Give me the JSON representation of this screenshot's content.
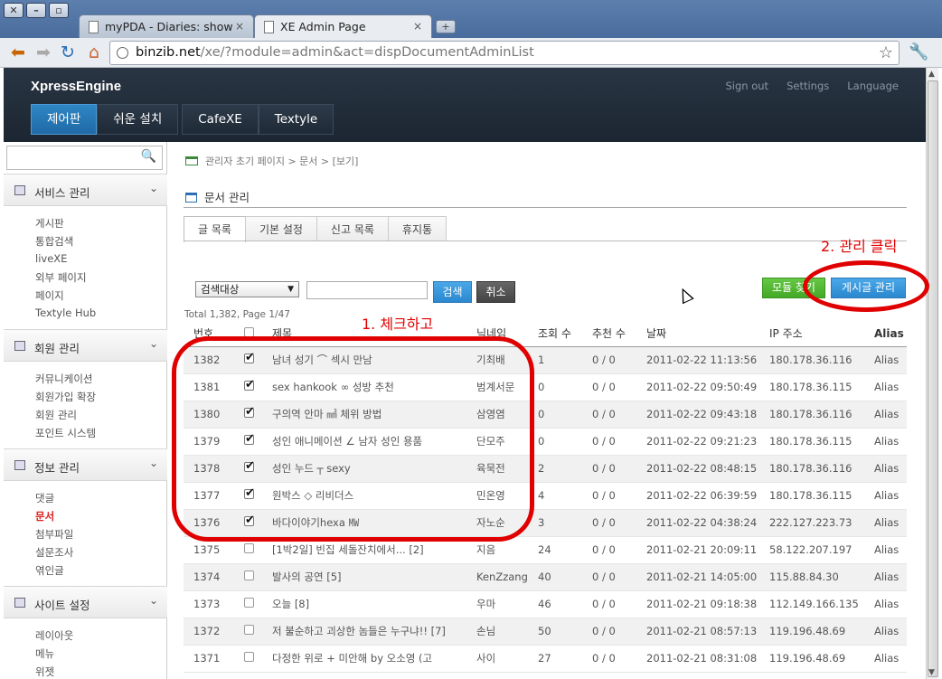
{
  "browser": {
    "tabs": [
      {
        "label": "myPDA - Diaries: show",
        "close": "×"
      },
      {
        "label": "XE Admin Page",
        "close": "×"
      }
    ],
    "new_tab": "+",
    "url_host": "binzib.net",
    "url_path": "/xe/?module=admin&act=dispDocumentAdminList"
  },
  "xe": {
    "brand": "XpressEngine",
    "top_links": [
      "Sign out",
      "Settings",
      "Language"
    ],
    "nav": [
      "제어판",
      "쉬운 설치",
      "CafeXE",
      "Textyle"
    ]
  },
  "sidebar": {
    "sections": [
      {
        "title": "서비스 관리",
        "items": [
          "게시판",
          "통합검색",
          "liveXE",
          "외부 페이지",
          "페이지",
          "Textyle Hub"
        ]
      },
      {
        "title": "회원 관리",
        "items": [
          "커뮤니케이션",
          "회원가입 확장",
          "회원 관리",
          "포인트 시스템"
        ]
      },
      {
        "title": "정보 관리",
        "items": [
          "댓글",
          "문서",
          "첨부파일",
          "설문조사",
          "엮인글"
        ]
      },
      {
        "title": "사이트 설정",
        "items": [
          "레이아웃",
          "메뉴",
          "위젯"
        ]
      }
    ]
  },
  "main": {
    "breadcrumb": "관리자 초기 페이지 > 문서 > [보기]",
    "section_title": "문서 관리",
    "tabs": [
      "글 목록",
      "기본 설정",
      "신고 목록",
      "휴지통"
    ],
    "search_target": "검색대상",
    "search_button": "검색",
    "cancel_button": "취소",
    "module_button": "모듈 찾기",
    "manage_button": "게시글 관리",
    "total": "Total 1,382, Page 1/47",
    "headers": [
      "번호",
      "",
      "제목",
      "닉네임",
      "조회 수",
      "추천 수",
      "날짜",
      "IP 주소",
      "Alias"
    ],
    "rows": [
      {
        "no": "1382",
        "checked": true,
        "title": "남녀 성기 ⌒ 섹시 만남",
        "nick": "기최배",
        "views": "1",
        "votes": "0 / 0",
        "date": "2011-02-22 11:13:56",
        "ip": "180.178.36.116",
        "alias": "Alias"
      },
      {
        "no": "1381",
        "checked": true,
        "title": "sex hankook ∞ 성방 추천",
        "nick": "범계서문",
        "views": "0",
        "votes": "0 / 0",
        "date": "2011-02-22 09:50:49",
        "ip": "180.178.36.115",
        "alias": "Alias"
      },
      {
        "no": "1380",
        "checked": true,
        "title": "구의역 안마 ㎟ 체위 방법",
        "nick": "삼영염",
        "views": "0",
        "votes": "0 / 0",
        "date": "2011-02-22 09:43:18",
        "ip": "180.178.36.116",
        "alias": "Alias"
      },
      {
        "no": "1379",
        "checked": true,
        "title": "성인 애니메이션 ∠ 남자 성인 용품",
        "nick": "단모주",
        "views": "0",
        "votes": "0 / 0",
        "date": "2011-02-22 09:21:23",
        "ip": "180.178.36.115",
        "alias": "Alias"
      },
      {
        "no": "1378",
        "checked": true,
        "title": "성인 누드 ┬ sexy",
        "nick": "육묵전",
        "views": "2",
        "votes": "0 / 0",
        "date": "2011-02-22 08:48:15",
        "ip": "180.178.36.116",
        "alias": "Alias"
      },
      {
        "no": "1377",
        "checked": true,
        "title": "원박스 ◇ 리비더스",
        "nick": "민온영",
        "views": "4",
        "votes": "0 / 0",
        "date": "2011-02-22 06:39:59",
        "ip": "180.178.36.115",
        "alias": "Alias"
      },
      {
        "no": "1376",
        "checked": true,
        "title": "바다이야기hexa ㎿",
        "nick": "자노순",
        "views": "3",
        "votes": "0 / 0",
        "date": "2011-02-22 04:38:24",
        "ip": "222.127.223.73",
        "alias": "Alias"
      },
      {
        "no": "1375",
        "checked": false,
        "title": "[1박2일] 빈집 세돌잔치에서... [2]",
        "nick": "지음",
        "views": "24",
        "votes": "0 / 0",
        "date": "2011-02-21 20:09:11",
        "ip": "58.122.207.197",
        "alias": "Alias"
      },
      {
        "no": "1374",
        "checked": false,
        "title": "발사의 공연 [5]",
        "nick": "KenZzang",
        "views": "40",
        "votes": "0 / 0",
        "date": "2011-02-21 14:05:00",
        "ip": "115.88.84.30",
        "alias": "Alias"
      },
      {
        "no": "1373",
        "checked": false,
        "title": "오늘 [8]",
        "nick": "우마",
        "views": "46",
        "votes": "0 / 0",
        "date": "2011-02-21 09:18:38",
        "ip": "112.149.166.135",
        "alias": "Alias"
      },
      {
        "no": "1372",
        "checked": false,
        "title": "저 불순하고 괴상한 놈들은 누구냐!! [7]",
        "nick": "손님",
        "views": "50",
        "votes": "0 / 0",
        "date": "2011-02-21 08:57:13",
        "ip": "119.196.48.69",
        "alias": "Alias"
      },
      {
        "no": "1371",
        "checked": false,
        "title": "다정한 위로 + 미안해 by 오소영 (고",
        "nick": "사이",
        "views": "27",
        "votes": "0 / 0",
        "date": "2011-02-21 08:31:08",
        "ip": "119.196.48.69",
        "alias": "Alias"
      }
    ]
  },
  "annotations": {
    "step1": "1. 체크하고",
    "step2": "2. 관리 클릭",
    "color": "#e00000"
  }
}
